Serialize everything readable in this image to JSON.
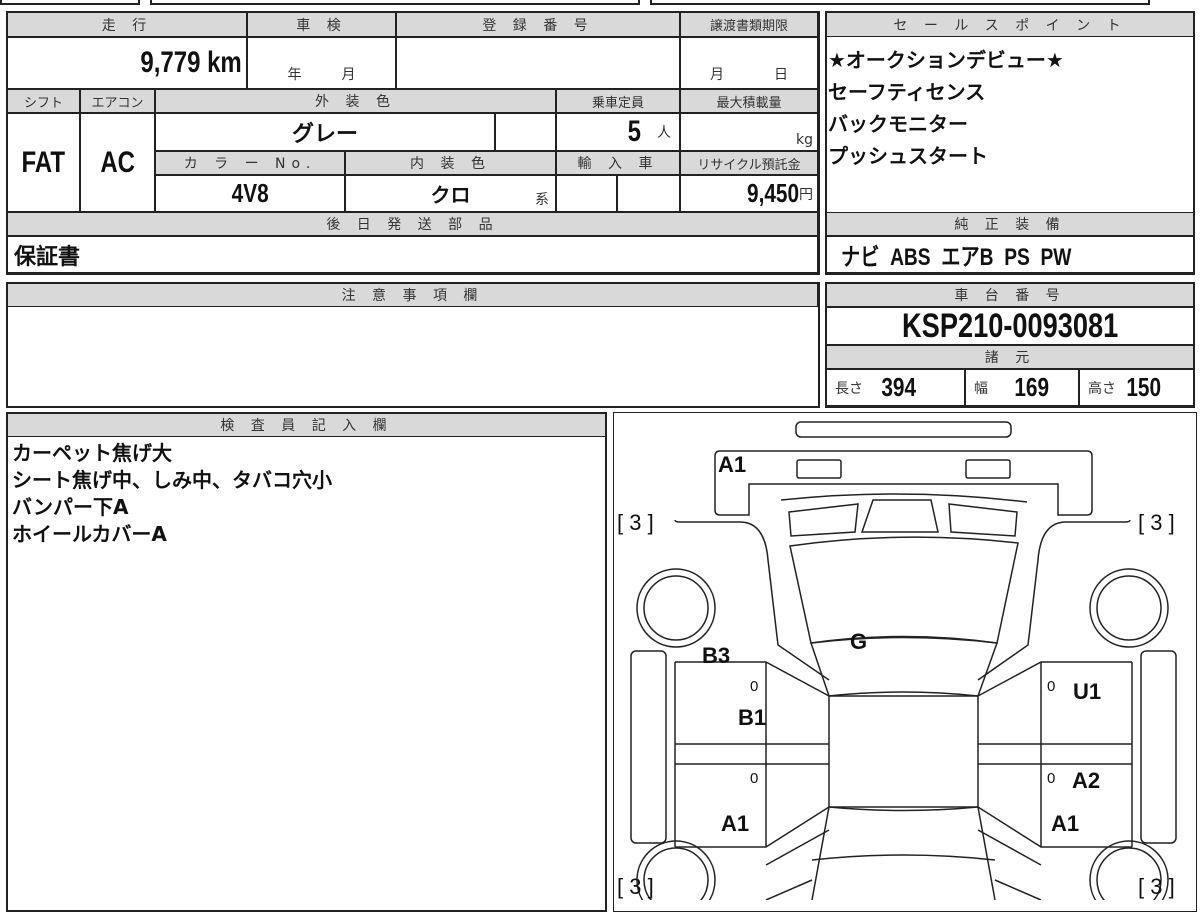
{
  "headers": {
    "mileage": "走 行",
    "inspection": "車 検",
    "registration": "登 録 番 号",
    "transfer_deadline": "譲渡書類期限",
    "shift": "シフト",
    "aircon": "エアコン",
    "exterior_color": "外 装 色",
    "capacity": "乗車定員",
    "max_load": "最大積載量",
    "color_no": "カ ラ ー No.",
    "interior_color": "内 装 色",
    "import": "輸 入 車",
    "recycle_fee": "リサイクル預託金",
    "later_parts": "後 日 発 送 部 品",
    "notes": "注 意 事 項 欄",
    "sales_points": "セ ー ル ス ポ イ ン ト",
    "factory_equipment": "純 正 装 備",
    "chassis_no": "車 台 番 号",
    "specs": "諸 元",
    "inspector": "検 査 員 記 入 欄"
  },
  "values": {
    "mileage": "9,779 km",
    "inspection_year_unit": "年",
    "inspection_month_unit": "月",
    "deadline_month_unit": "月",
    "deadline_day_unit": "日",
    "shift": "FAT",
    "aircon": "AC",
    "exterior_color": "グレー",
    "capacity": "5",
    "capacity_unit": "人",
    "load_unit": "kg",
    "color_no": "4V8",
    "interior_color": "クロ",
    "interior_suffix": "系",
    "recycle_fee": "9,450",
    "yen_unit": "円",
    "later_parts": "保証書"
  },
  "sales_points": [
    "★オークションデビュー★",
    "セーフティセンス",
    "バックモニター",
    "プッシュスタート"
  ],
  "equipment": "ナビ  ABS  エアB  PS  PW",
  "chassis_no": "KSP210-0093081",
  "specs": {
    "length_label": "長さ",
    "length": "394",
    "width_label": "幅",
    "width": "169",
    "height_label": "高さ",
    "height": "150"
  },
  "inspector_notes": [
    "カーペット焦げ大",
    "シート焦げ中、しみ中、タバコ穴小",
    "バンパー下A",
    "ホイールカバーA"
  ],
  "diagram": {
    "rear_bumper": "A1",
    "tire_rl": "[ 3 ]",
    "tire_rr": "[ 3 ]",
    "tire_fl": "[ 3 ]",
    "tire_fr": "[ 3 ]",
    "glass": "G",
    "left_rear_door": "B3",
    "left_pillar": "B1",
    "right_rear_door": "U1",
    "right_front_door": "A2",
    "left_front_fender": "A1",
    "right_front_fender": "A1",
    "zero": "0"
  }
}
